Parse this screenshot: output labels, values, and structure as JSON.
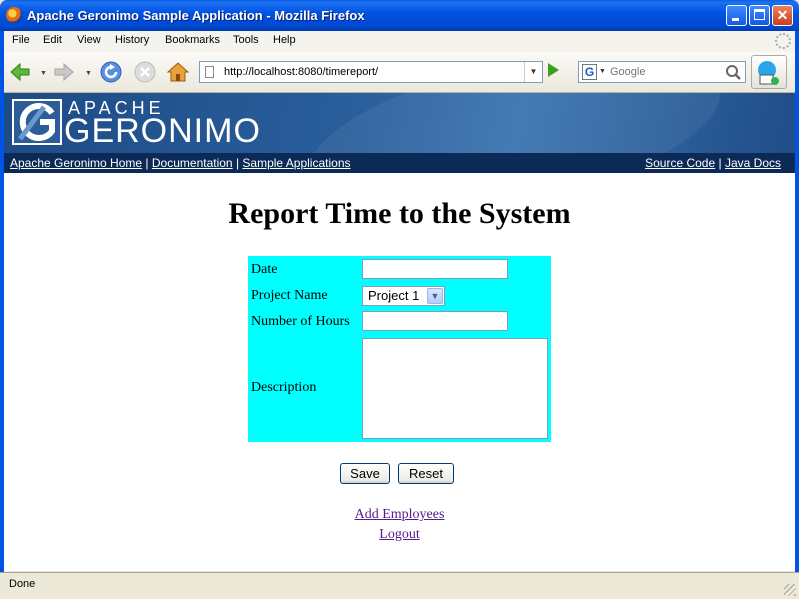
{
  "window": {
    "title": "Apache Geronimo Sample Application - Mozilla Firefox"
  },
  "menubar": {
    "items": [
      "File",
      "Edit",
      "View",
      "History",
      "Bookmarks",
      "Tools",
      "Help"
    ]
  },
  "navbar": {
    "url": "http://localhost:8080/timereport/",
    "search_placeholder": "Google",
    "search_engine_letter": "G"
  },
  "banner": {
    "logo_top": "APACHE",
    "logo_main": "GERONIMO",
    "links_left": [
      "Apache Geronimo Home",
      "Documentation",
      "Sample Applications"
    ],
    "links_right": [
      "Source Code",
      "Java Docs"
    ],
    "separator": "|"
  },
  "page": {
    "heading": "Report Time to the System",
    "form": {
      "date_label": "Date",
      "project_label": "Project Name",
      "project_value": "Project 1",
      "hours_label": "Number of Hours",
      "description_label": "Description",
      "background_color": "#00ffff"
    },
    "buttons": {
      "save": "Save",
      "reset": "Reset"
    },
    "links": {
      "add_employees": "Add Employees",
      "logout": "Logout"
    }
  },
  "statusbar": {
    "text": "Done"
  }
}
